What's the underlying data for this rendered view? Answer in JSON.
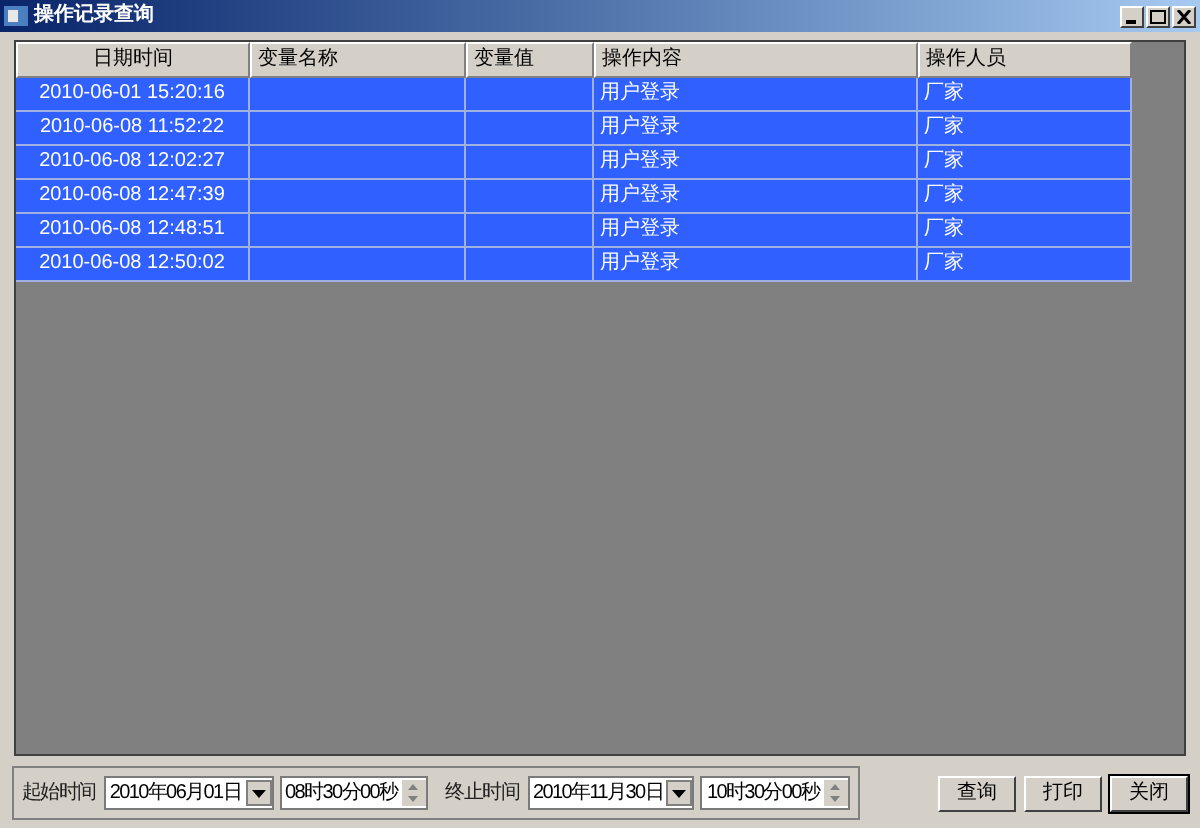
{
  "window": {
    "title": "操作记录查询"
  },
  "table": {
    "columns": [
      "日期时间",
      "变量名称",
      "变量值",
      "操作内容",
      "操作人员"
    ],
    "rows": [
      {
        "selected": true,
        "cells": [
          "2010-06-01 15:20:16",
          "",
          "",
          "用户登录",
          "厂家"
        ]
      },
      {
        "selected": true,
        "cells": [
          "2010-06-08 11:52:22",
          "",
          "",
          "用户登录",
          "厂家"
        ]
      },
      {
        "selected": true,
        "cells": [
          "2010-06-08 12:02:27",
          "",
          "",
          "用户登录",
          "厂家"
        ]
      },
      {
        "selected": true,
        "cells": [
          "2010-06-08 12:47:39",
          "",
          "",
          "用户登录",
          "厂家"
        ]
      },
      {
        "selected": true,
        "cells": [
          "2010-06-08 12:48:51",
          "",
          "",
          "用户登录",
          "厂家"
        ]
      },
      {
        "selected": true,
        "cells": [
          "2010-06-08 12:50:02",
          "",
          "",
          "用户登录",
          "厂家"
        ]
      }
    ]
  },
  "filter": {
    "start_label": "起始时间",
    "start_date": "2010年06月01日",
    "start_time": "08时30分00秒",
    "end_label": "终止时间",
    "end_date": "2010年11月30日",
    "end_time": "10时30分00秒"
  },
  "buttons": [
    "查询",
    "打印",
    "关闭"
  ]
}
